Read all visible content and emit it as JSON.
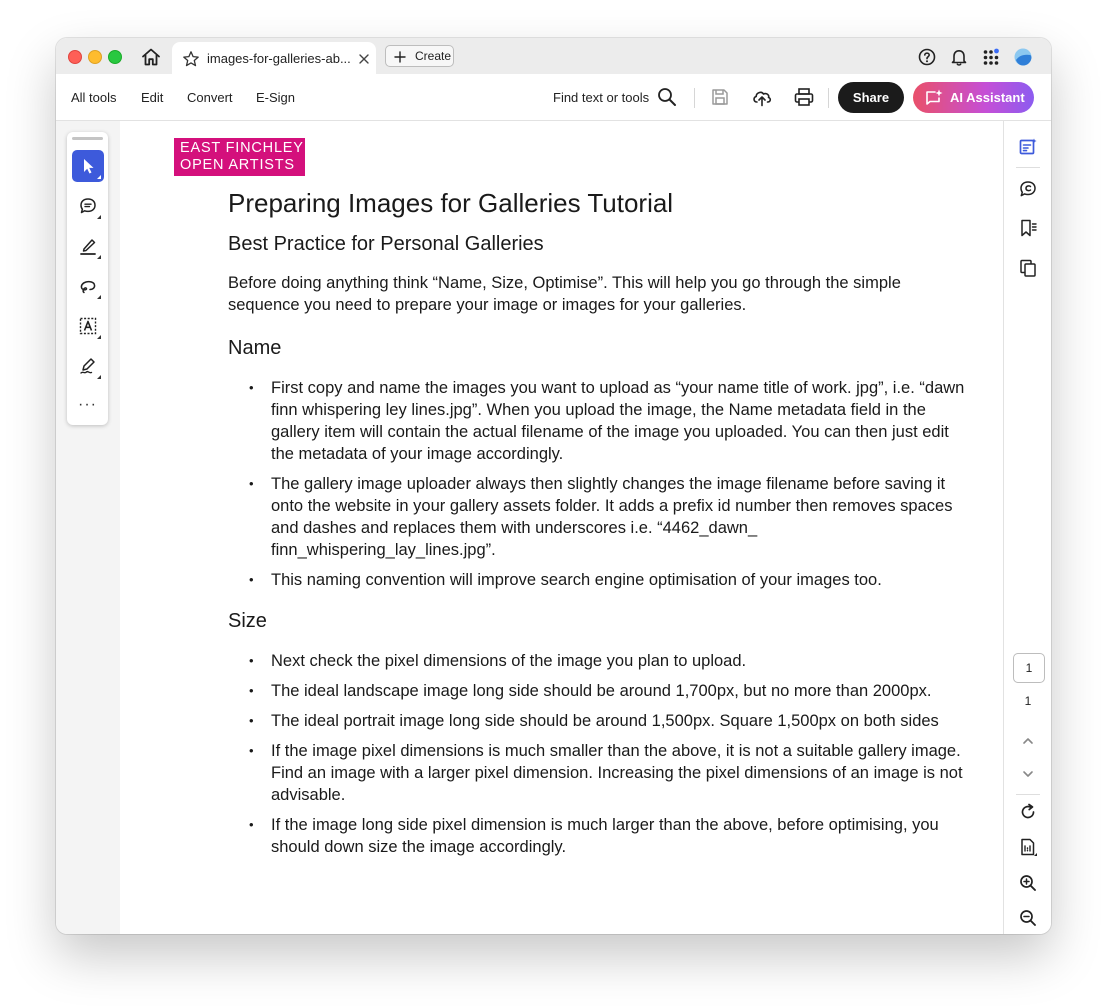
{
  "titlebar": {
    "tab_title": "images-for-galleries-ab...",
    "create_label": "Create"
  },
  "menubar": {
    "items": [
      "All tools",
      "Edit",
      "Convert",
      "E-Sign"
    ],
    "find_label": "Find text or tools",
    "share_label": "Share",
    "ai_label": "AI Assistant"
  },
  "pager": {
    "current": "1",
    "total": "1"
  },
  "logo": {
    "line1": "EAST FINCHLEY",
    "line2": "OPEN ARTISTS",
    "color": "#d4107c"
  },
  "document": {
    "title": "Preparing Images for Galleries Tutorial",
    "subtitle": "Best Practice for Personal Galleries",
    "intro": "Before doing anything think “Name, Size, Optimise”. This will help you go through the simple sequence you need to prepare your image or images for your galleries.",
    "sections": [
      {
        "heading": "Name",
        "bullets": [
          "First copy and name the images you want to upload as “your name title of work. jpg”, i.e. “dawn finn whispering ley lines.jpg”. When you upload the image, the Name metadata field in the gallery item will contain the actual filename of the image you uploaded. You can then just edit the metadata of your image accordingly.",
          "The gallery image uploader always then slightly changes the image filename before saving it onto the website in your gallery assets folder. It adds a prefix id number then removes spaces and dashes and replaces them with underscores i.e. “4462_dawn_ finn_whispering_lay_lines.jpg”.",
          "This naming convention will improve search engine optimisation of your images too."
        ]
      },
      {
        "heading": "Size",
        "bullets": [
          "Next check the pixel dimensions of the image you plan to upload.",
          "The ideal landscape image long side should be around 1,700px, but no more than 2000px.",
          "The ideal portrait image long side should be around 1,500px. Square 1,500px on both sides",
          "If the image pixel dimensions is much smaller than the above, it is not a suitable gallery image. Find an image with a larger pixel dimension. Increasing the pixel dimensions of an image is not advisable.",
          "If the image long side pixel dimension is much larger than the above, before optimising, you should down size the image accordingly."
        ]
      }
    ]
  },
  "colors": {
    "active_tool": "#3d5adb",
    "share_bg": "#1b1b1b",
    "ai_gradient_start": "#e9506a",
    "ai_gradient_end": "#8c5cf0"
  },
  "icons": {
    "tools": [
      "select-cursor-icon",
      "add-comment-icon",
      "highlight-pen-icon",
      "draw-freeform-icon",
      "text-select-icon",
      "fill-sign-icon"
    ],
    "right_rail": [
      "edit-pdf-icon",
      "comments-panel-icon",
      "bookmarks-icon",
      "page-thumbnails-icon",
      "chevron-up-icon",
      "chevron-down-icon",
      "rotate-icon",
      "fit-page-icon",
      "zoom-in-icon",
      "zoom-out-icon"
    ]
  }
}
